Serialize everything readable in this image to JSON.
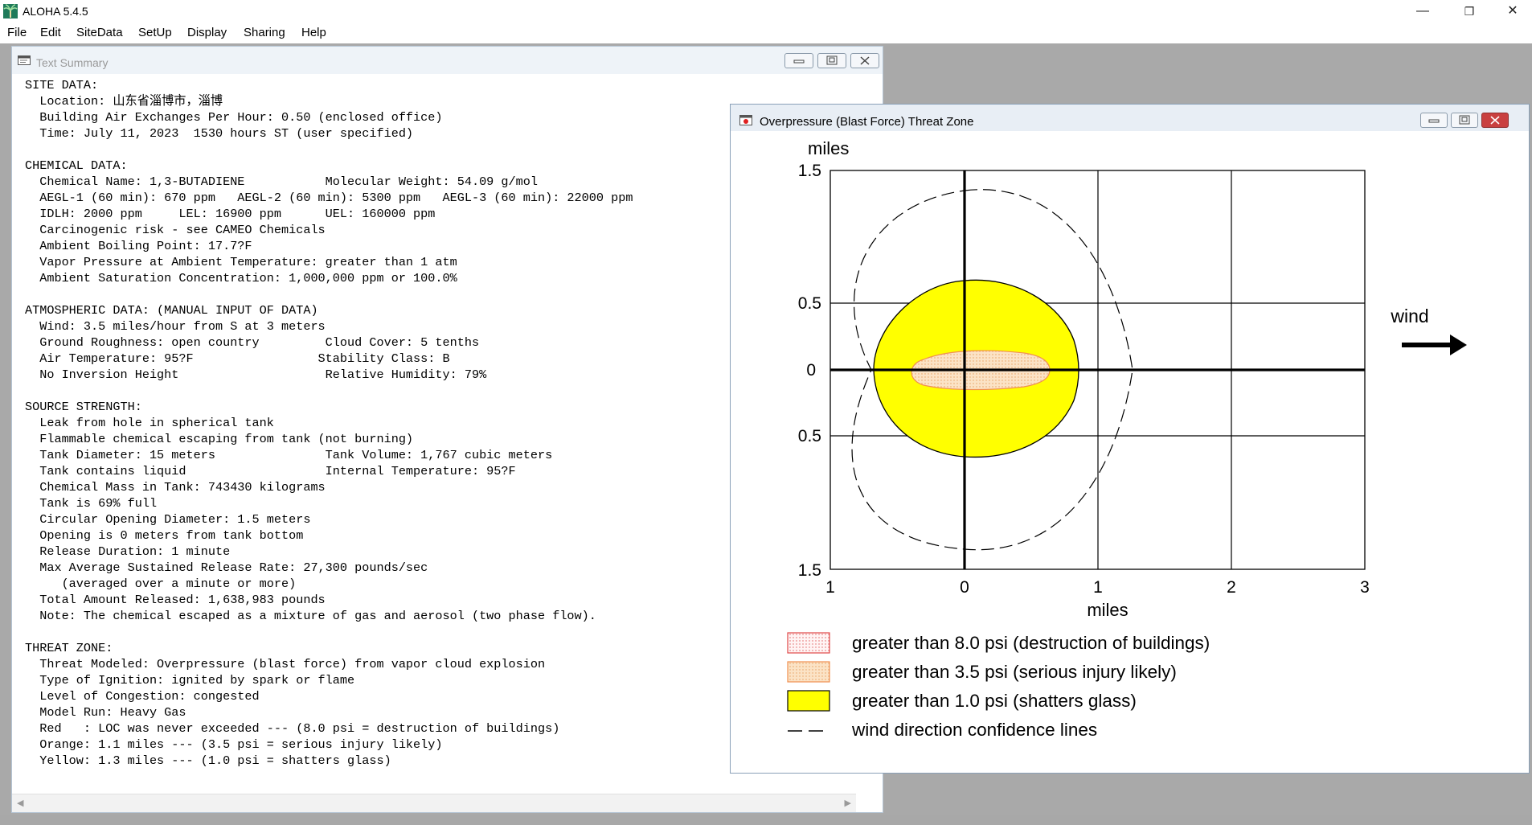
{
  "app": {
    "title": "ALOHA 5.4.5"
  },
  "window_controls": {
    "minimize": "—",
    "restore": "❐",
    "close": "✕"
  },
  "menu": [
    "File",
    "Edit",
    "SiteData",
    "SetUp",
    "Display",
    "Sharing",
    "Help"
  ],
  "text_summary": {
    "title": "Text Summary",
    "lines": [
      "SITE DATA:",
      "  Location: 山东省淄博市，淄博",
      "  Building Air Exchanges Per Hour: 0.50 (enclosed office)",
      "  Time: July 11, 2023  1530 hours ST (user specified)",
      "",
      "CHEMICAL DATA:",
      "  Chemical Name: 1,3-BUTADIENE           Molecular Weight: 54.09 g/mol",
      "  AEGL-1 (60 min): 670 ppm   AEGL-2 (60 min): 5300 ppm   AEGL-3 (60 min): 22000 ppm",
      "  IDLH: 2000 ppm     LEL: 16900 ppm      UEL: 160000 ppm",
      "  Carcinogenic risk - see CAMEO Chemicals",
      "  Ambient Boiling Point: 17.7?F",
      "  Vapor Pressure at Ambient Temperature: greater than 1 atm",
      "  Ambient Saturation Concentration: 1,000,000 ppm or 100.0%",
      "",
      "ATMOSPHERIC DATA: (MANUAL INPUT OF DATA)",
      "  Wind: 3.5 miles/hour from S at 3 meters",
      "  Ground Roughness: open country         Cloud Cover: 5 tenths",
      "  Air Temperature: 95?F                 Stability Class: B",
      "  No Inversion Height                    Relative Humidity: 79%",
      "",
      "SOURCE STRENGTH:",
      "  Leak from hole in spherical tank",
      "  Flammable chemical escaping from tank (not burning)",
      "  Tank Diameter: 15 meters               Tank Volume: 1,767 cubic meters",
      "  Tank contains liquid                   Internal Temperature: 95?F",
      "  Chemical Mass in Tank: 743430 kilograms",
      "  Tank is 69% full",
      "  Circular Opening Diameter: 1.5 meters",
      "  Opening is 0 meters from tank bottom",
      "  Release Duration: 1 minute",
      "  Max Average Sustained Release Rate: 27,300 pounds/sec",
      "     (averaged over a minute or more)",
      "  Total Amount Released: 1,638,983 pounds",
      "  Note: The chemical escaped as a mixture of gas and aerosol (two phase flow).",
      "",
      "THREAT ZONE:",
      "  Threat Modeled: Overpressure (blast force) from vapor cloud explosion",
      "  Type of Ignition: ignited by spark or flame",
      "  Level of Congestion: congested",
      "  Model Run: Heavy Gas",
      "  Red   : LOC was never exceeded --- (8.0 psi = destruction of buildings)",
      "  Orange: 1.1 miles --- (3.5 psi = serious injury likely)",
      "  Yellow: 1.3 miles --- (1.0 psi = shatters glass)"
    ]
  },
  "threat_window": {
    "title": "Overpressure (Blast Force) Threat Zone",
    "y_unit": "miles",
    "x_label": "miles",
    "x_ticks": [
      "1",
      "0",
      "1",
      "2",
      "3"
    ],
    "y_ticks": [
      "1.5",
      "0.5",
      "0",
      "0.5",
      "1.5"
    ],
    "wind_label": "wind",
    "legend": [
      {
        "label": "greater than 8.0 psi (destruction of buildings)",
        "color": "#e04848"
      },
      {
        "label": "greater than 3.5 psi (serious injury likely)",
        "color": "#f5a050"
      },
      {
        "label": "greater than 1.0 psi (shatters glass)",
        "color": "#ffff00"
      },
      {
        "label": "wind direction confidence lines",
        "color": "#000000"
      }
    ],
    "yellow_zone_downwind_miles": 1.3,
    "orange_zone_downwind_miles": 1.1
  }
}
